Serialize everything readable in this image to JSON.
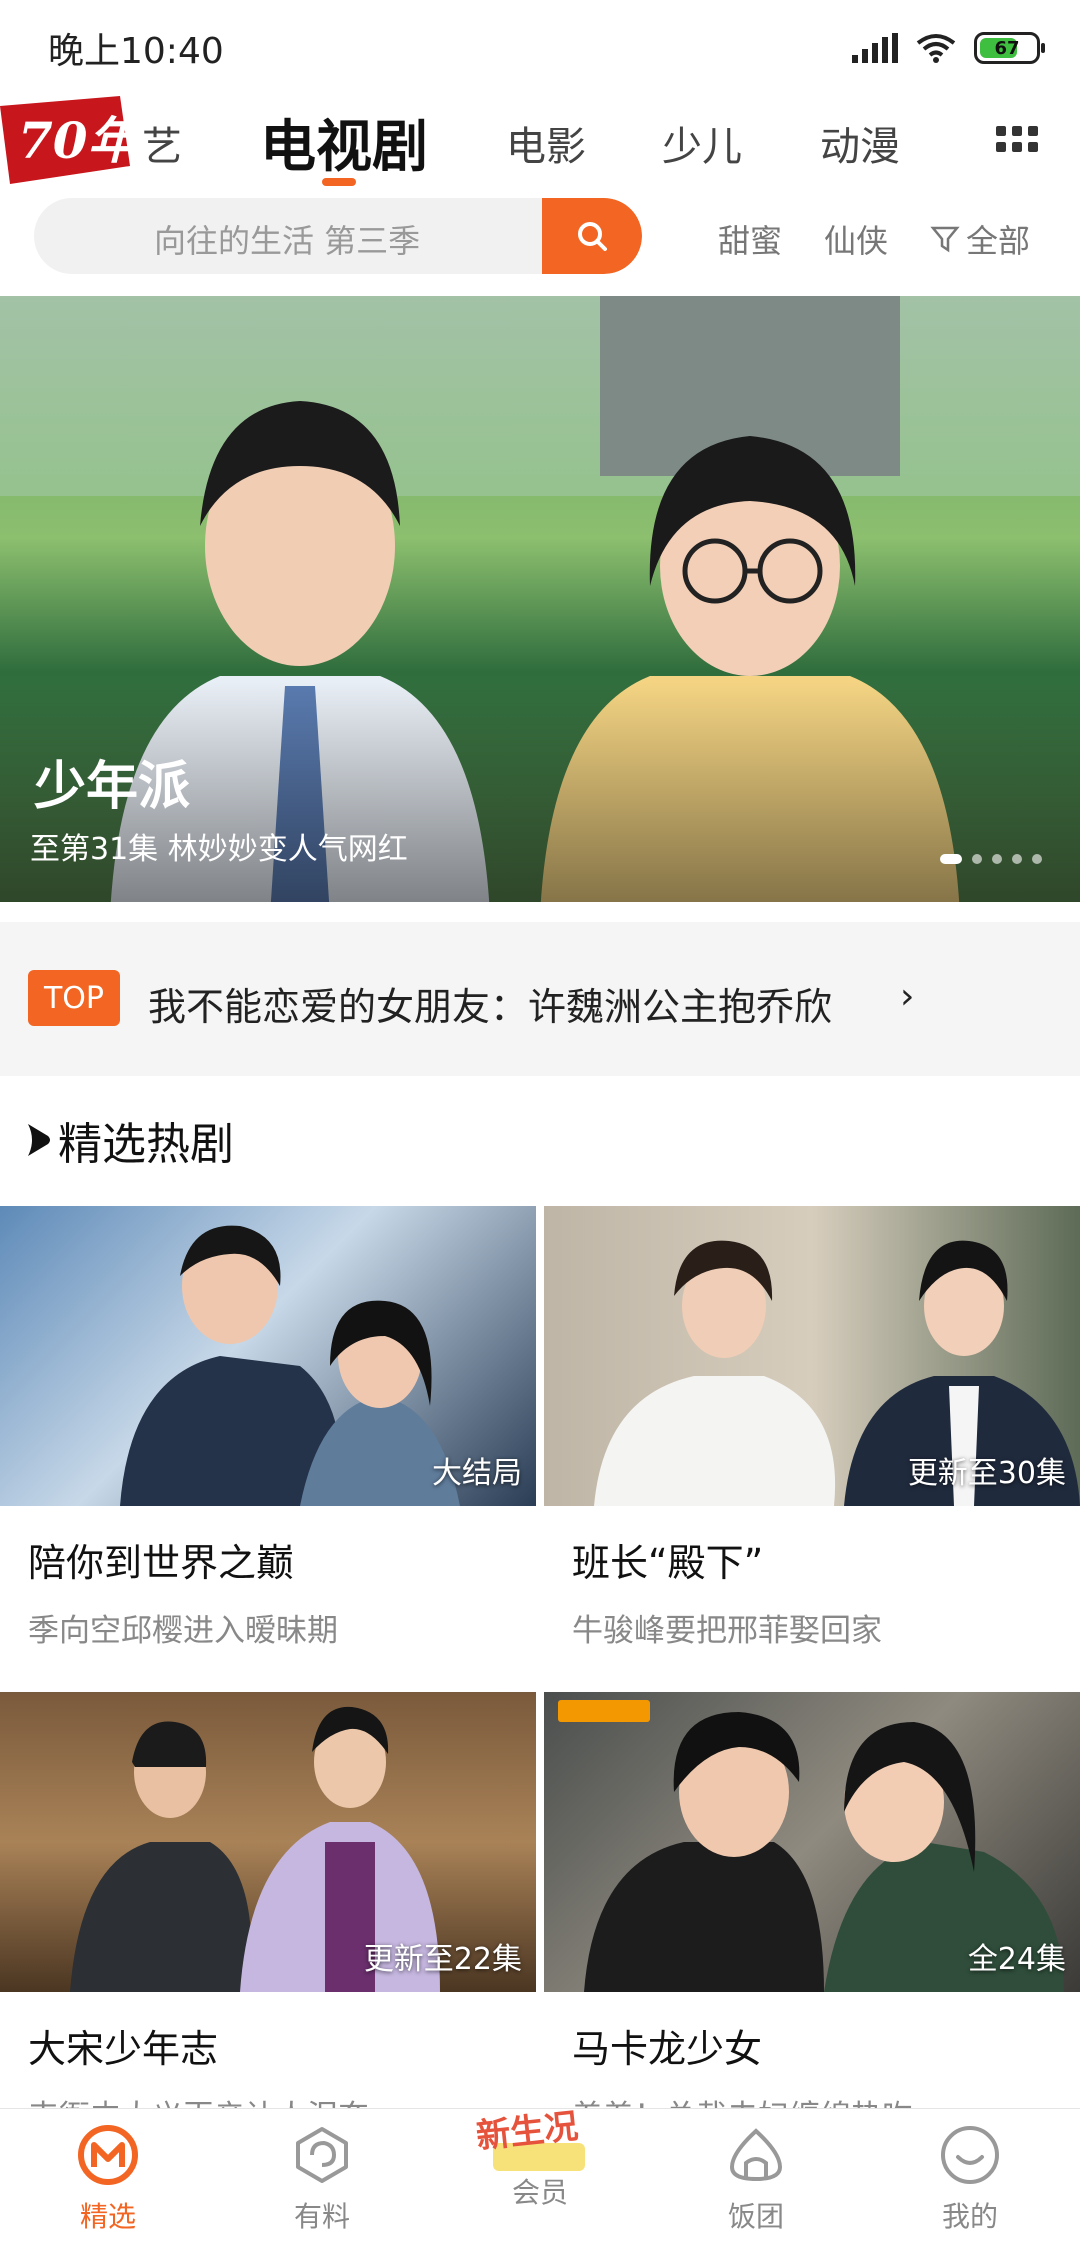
{
  "status_bar": {
    "time": "晚上10:40",
    "battery": "67"
  },
  "nav": {
    "logo_text": "70年",
    "tabs": [
      {
        "label": "艺",
        "active": false
      },
      {
        "label": "电视剧",
        "active": true
      },
      {
        "label": "电影",
        "active": false
      },
      {
        "label": "少儿",
        "active": false
      },
      {
        "label": "动漫",
        "active": false
      }
    ],
    "more_icon": "grid-icon"
  },
  "search": {
    "placeholder": "向往的生活 第三季",
    "quick_tags": [
      "甜蜜",
      "仙侠"
    ],
    "filter_label": "全部"
  },
  "banner": {
    "title": "少年派",
    "subtitle": "至第31集 林妙妙变人气网红",
    "dots": 5,
    "active_dot": 0
  },
  "top_row": {
    "badge": "TOP",
    "text": "我不能恋爱的女朋友：许魏洲公主抱乔欣",
    "arrow": "›"
  },
  "section": {
    "title": "精选热剧"
  },
  "cards": [
    {
      "title": "陪你到世界之巅",
      "subtitle": "季向空邱樱进入暧昧期",
      "corner": "大结局"
    },
    {
      "title": "班长“殿下”",
      "subtitle": "牛骏峰要把邢菲娶回家",
      "corner": "更新至30集"
    },
    {
      "title": "大宋少年志",
      "subtitle": "韦衙内大义灭亲让人泪奔",
      "corner": "更新至22集"
    },
    {
      "title": "马卡龙少女",
      "subtitle": "羞羞！总裁夫妇缠绵热吻",
      "corner": "全24集"
    }
  ],
  "bottom_nav": [
    {
      "label": "精选",
      "icon": "mango-logo-icon",
      "active": true
    },
    {
      "label": "有料",
      "icon": "swirl-icon",
      "active": false
    },
    {
      "label": "会员",
      "icon": "new-life-badge-icon",
      "active": false,
      "badge_text": "新生况"
    },
    {
      "label": "饭团",
      "icon": "rice-ball-icon",
      "active": false
    },
    {
      "label": "我的",
      "icon": "smile-icon",
      "active": false
    }
  ],
  "colors": {
    "accent": "#f26522"
  }
}
